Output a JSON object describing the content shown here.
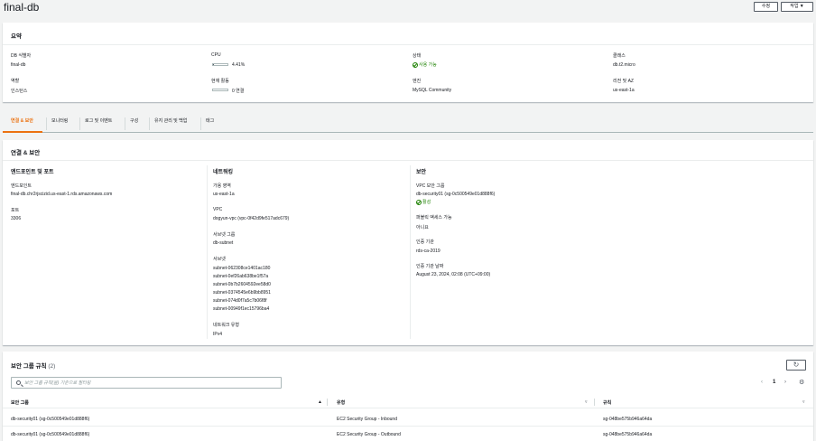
{
  "header": {
    "title": "final-db",
    "edit_label": "수정",
    "actions_label": "작업 ▼"
  },
  "summary": {
    "title": "요약",
    "db_id_label": "DB 식별자",
    "db_id_value": "final-db",
    "cpu_label": "CPU",
    "cpu_value": "4.41%",
    "cpu_fraction": 0.0441,
    "status_label": "상태",
    "status_value": "사용 가능",
    "class_label": "클래스",
    "class_value": "db.t2.micro",
    "role_label": "역할",
    "role_value": "인스턴스",
    "activity_label": "현재 활동",
    "activity_value": "0 연결",
    "activity_fraction": 0,
    "engine_label": "엔진",
    "engine_value": "MySQL Community",
    "region_label": "리전 및 AZ",
    "region_value": "us-east-1a"
  },
  "tabs": [
    {
      "label": "연결 & 보안",
      "active": true
    },
    {
      "label": "모니터링"
    },
    {
      "label": "로그 및 이벤트"
    },
    {
      "label": "구성"
    },
    {
      "label": "유지 관리 및 백업"
    },
    {
      "label": "태그"
    }
  ],
  "connectivity": {
    "title": "연결 & 보안",
    "endpoint_col": {
      "title": "엔드포인트 및 포트",
      "endpoint_label": "엔드포인트",
      "endpoint_value": "final-db.chr2rjscizid.us-east-1.rds.amazonaws.com",
      "port_label": "포트",
      "port_value": "3306"
    },
    "network_col": {
      "title": "네트워킹",
      "az_label": "가용 영역",
      "az_value": "us-east-1a",
      "vpc_label": "VPC",
      "vpc_value": "dogyun-vpc (vpc-0f42d9fe517adc679)",
      "subnet_group_label": "서브넷 그룹",
      "subnet_group_value": "db-subnet",
      "subnets_label": "서브넷",
      "subnets": [
        "subnet-062308ce1401ac180",
        "subnet-0ef26ab638be1f57a",
        "subnet-0b7b2604592ee58d0",
        "subnet-0374545e6b9bb8951",
        "subnet-074d0f7a5c7b06f8f",
        "subnet-00949f1ec15796ba4"
      ],
      "network_type_label": "네트워크 유형",
      "network_type_value": "IPv4"
    },
    "security_col": {
      "title": "보안",
      "vpc_sg_label": "VPC 보안 그룹",
      "vpc_sg_value": "db-security01 (sg-0c500549e01d888f6)",
      "vpc_sg_status": "활성",
      "public_label": "퍼블릭 액세스 가능",
      "public_value": "아니요",
      "ca_label": "인증 기관",
      "ca_value": "rds-ca-2019",
      "ca_date_label": "인증 기관 날짜",
      "ca_date_value": "August 23, 2024, 02:08 (UTC+09:00)"
    }
  },
  "sg_rules": {
    "title": "보안 그룹 규칙",
    "count": "(2)",
    "search_placeholder": "보안 그룹 규칙(을) 기준으로 필터링",
    "page": "1",
    "columns": [
      "보안 그룹",
      "유형",
      "규칙"
    ],
    "rows": [
      {
        "group": "db-security01 (sg-0c500549e01d888f6)",
        "type": "EC2 Security Group - Inbound",
        "rule": "sg-048be575b946a64da"
      },
      {
        "group": "db-security01 (sg-0c500549e01d888f6)",
        "type": "EC2 Security Group - Outbound",
        "rule": "sg-048be575b946a64da"
      }
    ]
  },
  "colors": {
    "link": "#0073bb",
    "ok": "#1d8102",
    "tab_active": "#ec7211"
  }
}
